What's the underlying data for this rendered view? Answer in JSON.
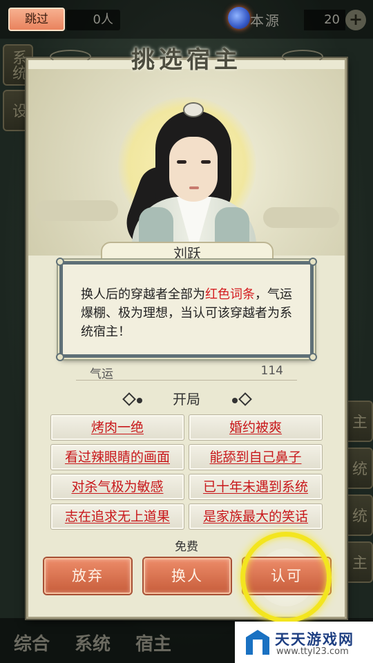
{
  "top_bar": {
    "skip_label": "跳过",
    "people_count": "0人",
    "origin_label": "本源",
    "origin_value": "20",
    "plus_label": "+"
  },
  "side_tabs": {
    "left_1": "系统",
    "left_2": "设",
    "right_1": "主",
    "right_2": "统",
    "right_3": "统",
    "right_4": "主"
  },
  "bottom_nav": {
    "items": [
      "综合",
      "系统",
      "宿主"
    ]
  },
  "panel": {
    "title": "挑选宿主",
    "host_name": "刘跃",
    "stat": {
      "label": "气运",
      "value": "114"
    },
    "section_title": "开局",
    "traits": [
      "烤肉一绝",
      "婚约被爽",
      "看过辣眼睛的画面",
      "能舔到自己鼻子",
      "对杀气极为敏感",
      "已十年未遇到系统",
      "志在追求无上道果",
      "是家族最大的笑话"
    ],
    "fee_label": "免费",
    "buttons": {
      "give_up": "放弃",
      "change": "换人",
      "accept": "认可"
    }
  },
  "tooltip": {
    "text_before": "换人后的穿越者全部为",
    "text_red": "红色词条",
    "text_after": "，气运爆棚、极为理想，当认可该穿越者为系统宿主！"
  },
  "watermark": {
    "title": "天天游戏网",
    "url": "www.ttyl23.com"
  },
  "colors": {
    "trait_red": "#c8171a",
    "button_orange": "#d96f4b",
    "highlight_yellow": "#f3e51f",
    "panel_bg": "#eae8d2"
  }
}
